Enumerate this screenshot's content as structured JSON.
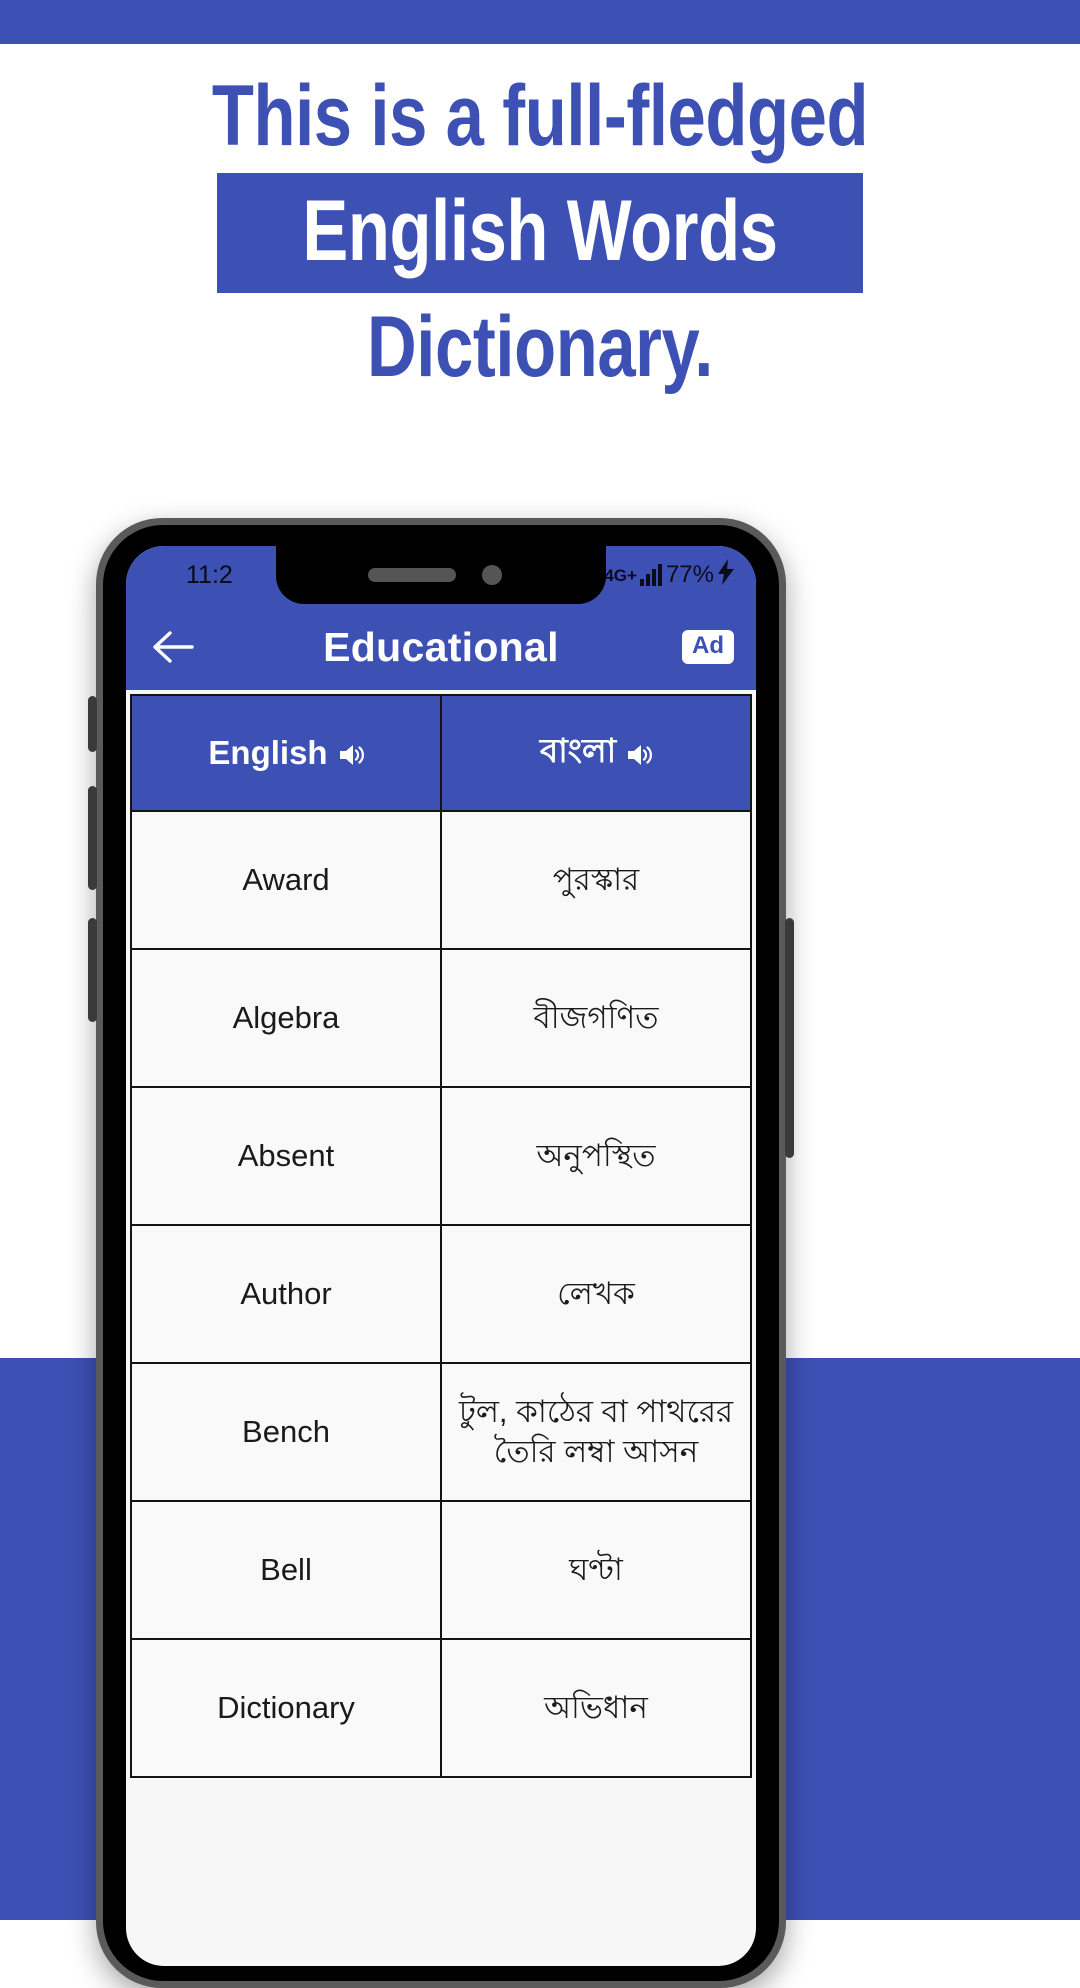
{
  "promo": {
    "line1": "This is a full-fledged",
    "line2": "English Words",
    "line3": "Dictionary.",
    "accent_color": "#3D51B5",
    "highlight_text_color": "#FFFFFF"
  },
  "phone": {
    "status_bar": {
      "time": "11:2",
      "network_type": "4G+",
      "signal_icon": "signal-bars-icon",
      "battery_percent": "77%",
      "charging_icon": "charging-bolt-icon"
    },
    "app_bar": {
      "back_icon": "back-arrow-icon",
      "title": "Educational",
      "ad_badge": "Ad"
    },
    "table": {
      "headers": [
        {
          "label": "English",
          "speaker_icon": "speaker-icon"
        },
        {
          "label": "বাংলা",
          "speaker_icon": "speaker-icon"
        }
      ],
      "rows": [
        {
          "english": "Award",
          "bangla": "পুরস্কার"
        },
        {
          "english": "Algebra",
          "bangla": "বীজগণিত"
        },
        {
          "english": "Absent",
          "bangla": "অনুপস্থিত"
        },
        {
          "english": "Author",
          "bangla": "লেখক"
        },
        {
          "english": "Bench",
          "bangla": "টুল, কাঠের বা পাথরের তৈরি লম্বা আসন"
        },
        {
          "english": "Bell",
          "bangla": "ঘণ্টা"
        },
        {
          "english": "Dictionary",
          "bangla": "অভিধান"
        }
      ]
    }
  }
}
